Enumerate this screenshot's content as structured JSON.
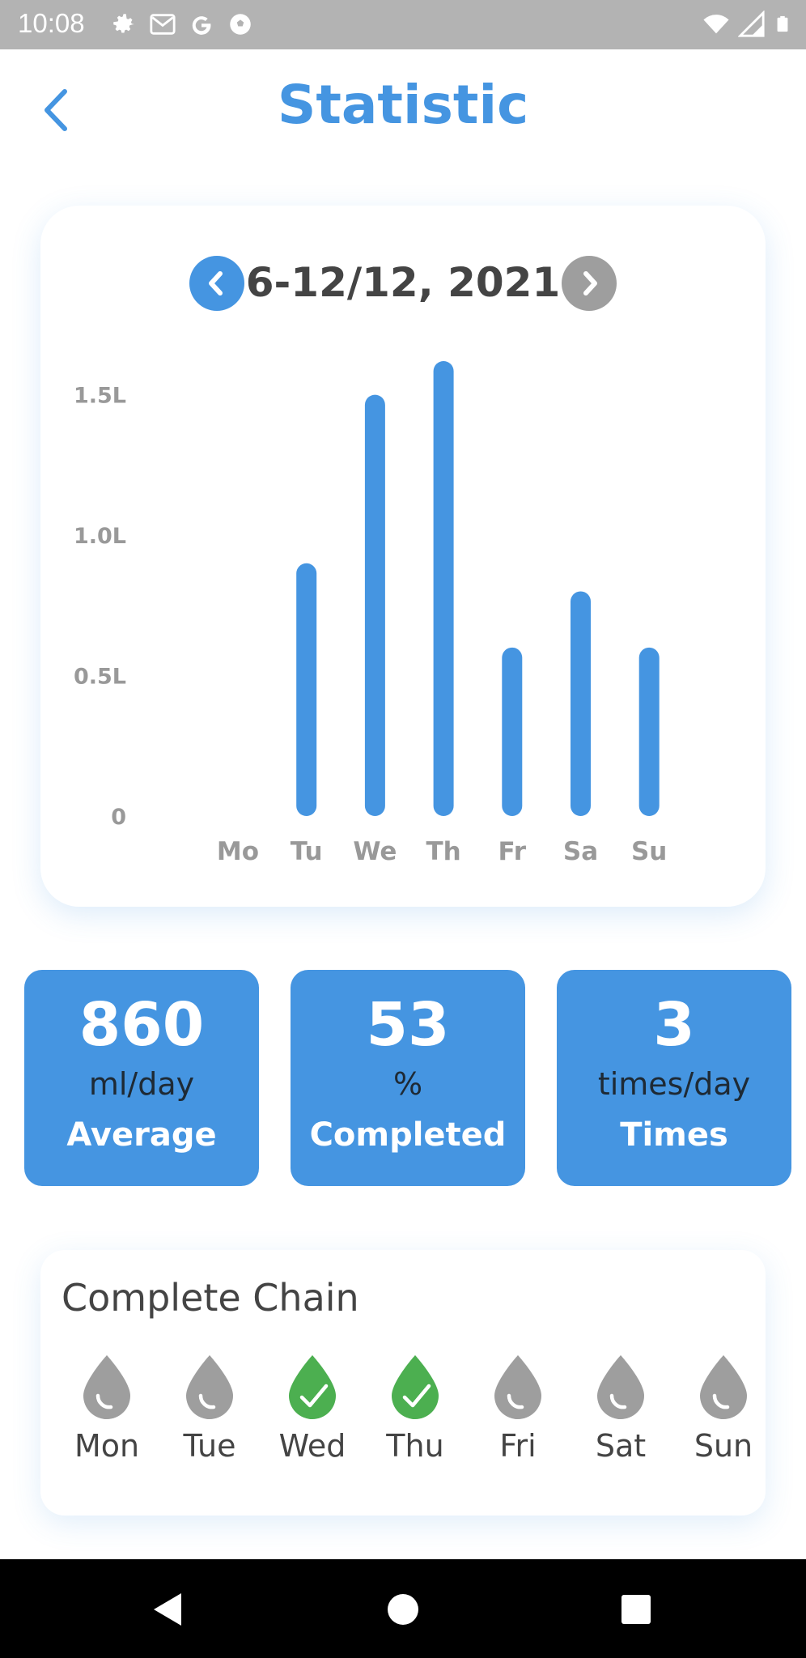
{
  "status_bar": {
    "time": "10:08",
    "left_icons": [
      "settings-icon",
      "gmail-icon",
      "google-icon",
      "soccer-ball-icon"
    ],
    "right_icons": [
      "wifi-icon",
      "signal-icon",
      "battery-icon"
    ]
  },
  "header": {
    "title": "Statistic",
    "back_icon": "chevron-left-icon"
  },
  "week_nav": {
    "label": "6-12/12, 2021",
    "prev_icon": "chevron-left-icon",
    "next_icon": "chevron-right-icon"
  },
  "chart_data": {
    "type": "bar",
    "categories": [
      "Mo",
      "Tu",
      "We",
      "Th",
      "Fr",
      "Sa",
      "Su"
    ],
    "values": [
      0,
      0.9,
      1.5,
      1.62,
      0.6,
      0.8,
      0.6
    ],
    "y_ticks": [
      "0",
      "0.5L",
      "1.0L",
      "1.5L"
    ],
    "y_tick_values": [
      0,
      0.5,
      1.0,
      1.5
    ],
    "ylim": [
      0,
      1.62
    ],
    "bar_color": "#4595e1",
    "grid": false
  },
  "stats": [
    {
      "value": "860",
      "unit": "ml/day",
      "label": "Average"
    },
    {
      "value": "53",
      "unit": "%",
      "label": "Completed"
    },
    {
      "value": "3",
      "unit": "times/day",
      "label": "Times"
    }
  ],
  "chain": {
    "title": "Complete Chain",
    "days": [
      {
        "label": "Mon",
        "completed": false
      },
      {
        "label": "Tue",
        "completed": false
      },
      {
        "label": "Wed",
        "completed": true
      },
      {
        "label": "Thu",
        "completed": true
      },
      {
        "label": "Fri",
        "completed": false
      },
      {
        "label": "Sat",
        "completed": false
      },
      {
        "label": "Sun",
        "completed": false
      }
    ],
    "completed_color": "#4caf50",
    "pending_color": "#9e9e9e"
  },
  "nav_bar": {
    "icons": [
      "back-triangle-icon",
      "home-circle-icon",
      "recents-square-icon"
    ]
  }
}
